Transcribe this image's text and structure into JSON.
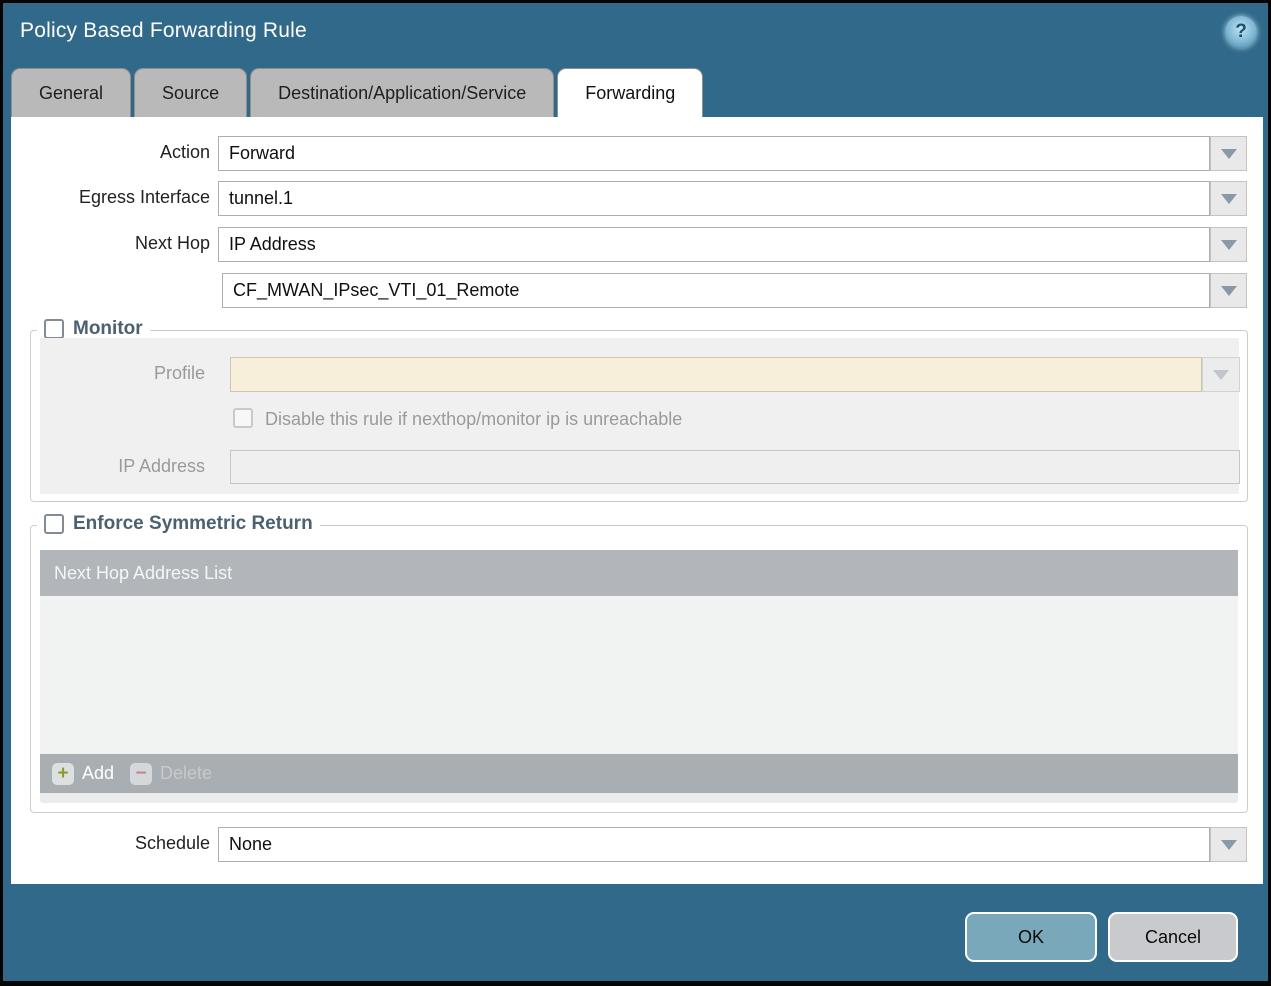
{
  "window": {
    "title": "Policy Based Forwarding Rule"
  },
  "help_icon": {
    "glyph": "?"
  },
  "tabs": [
    {
      "label": "General",
      "active": false
    },
    {
      "label": "Source",
      "active": false
    },
    {
      "label": "Destination/Application/Service",
      "active": false
    },
    {
      "label": "Forwarding",
      "active": true
    }
  ],
  "form": {
    "action": {
      "label": "Action",
      "value": "Forward"
    },
    "egress_interface": {
      "label": "Egress Interface",
      "value": "tunnel.1"
    },
    "next_hop": {
      "label": "Next Hop",
      "value": "IP Address"
    },
    "next_hop_address": {
      "value": "CF_MWAN_IPsec_VTI_01_Remote"
    },
    "schedule": {
      "label": "Schedule",
      "value": "None"
    }
  },
  "monitor": {
    "label": "Monitor",
    "checked": false,
    "profile": {
      "label": "Profile",
      "value": ""
    },
    "disable_rule": {
      "label": "Disable this rule if nexthop/monitor ip is unreachable",
      "checked": false
    },
    "ip_address": {
      "label": "IP Address",
      "value": ""
    }
  },
  "symmetric_return": {
    "label": "Enforce Symmetric Return",
    "checked": false,
    "table": {
      "header": "Next Hop Address List",
      "rows": []
    },
    "add_label": "Add",
    "delete_label": "Delete"
  },
  "footer": {
    "ok_label": "OK",
    "cancel_label": "Cancel"
  },
  "colors": {
    "titlebar": "#31698a",
    "active_tab": "#ffffff",
    "inactive_tab": "#b9b9b9",
    "disabled_field": "#f8efdb",
    "ok_button": "#7aa8bb",
    "cancel_button": "#c9cacd",
    "group_title": "#4b6172"
  }
}
